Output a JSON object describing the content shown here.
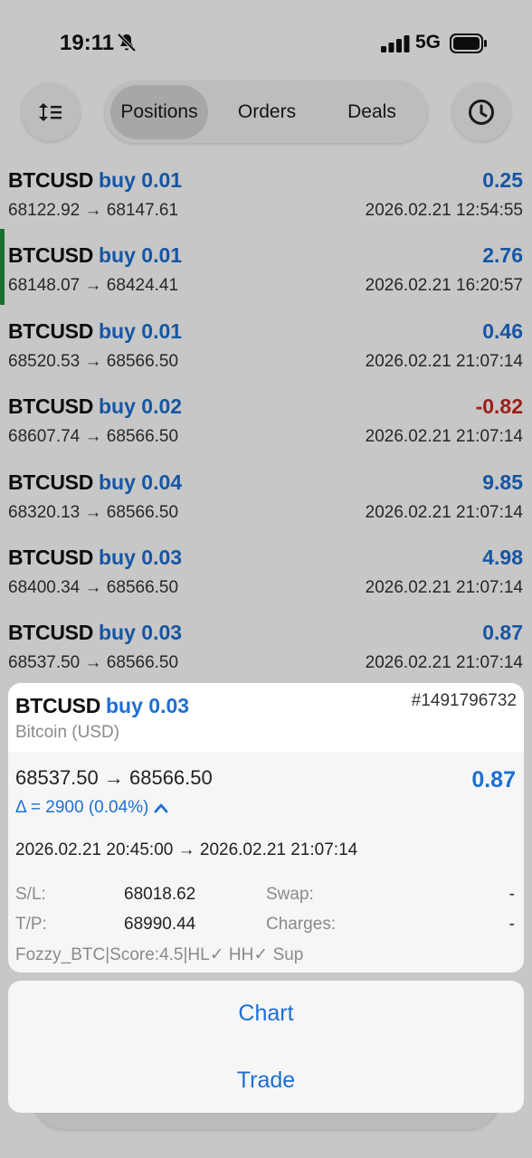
{
  "status": {
    "time": "19:11",
    "network": "5G"
  },
  "toolbar": {
    "tabs": [
      {
        "label": "Positions"
      },
      {
        "label": "Orders"
      },
      {
        "label": "Deals"
      }
    ]
  },
  "positions": [
    {
      "symbol": "BTCUSD",
      "side": "buy 0.01",
      "prices": "68122.92 → 68147.61",
      "profit": "0.25",
      "time": "2026.02.21 12:54:55"
    },
    {
      "symbol": "BTCUSD",
      "side": "buy 0.01",
      "prices": "68148.07 → 68424.41",
      "profit": "2.76",
      "time": "2026.02.21 16:20:57"
    },
    {
      "symbol": "BTCUSD",
      "side": "buy 0.01",
      "prices": "68520.53 → 68566.50",
      "profit": "0.46",
      "time": "2026.02.21 21:07:14"
    },
    {
      "symbol": "BTCUSD",
      "side": "buy 0.02",
      "prices": "68607.74 → 68566.50",
      "profit": "-0.82",
      "time": "2026.02.21 21:07:14"
    },
    {
      "symbol": "BTCUSD",
      "side": "buy 0.04",
      "prices": "68320.13 → 68566.50",
      "profit": "9.85",
      "time": "2026.02.21 21:07:14"
    },
    {
      "symbol": "BTCUSD",
      "side": "buy 0.03",
      "prices": "68400.34 → 68566.50",
      "profit": "4.98",
      "time": "2026.02.21 21:07:14"
    },
    {
      "symbol": "BTCUSD",
      "side": "buy 0.03",
      "prices": "68537.50 → 68566.50",
      "profit": "0.87",
      "time": "2026.02.21 21:07:14"
    }
  ],
  "detail": {
    "symbol": "BTCUSD",
    "side": "buy 0.03",
    "ticket": "#1491796732",
    "name": "Bitcoin (USD)",
    "prices": "68537.50 → 68566.50",
    "profit": "0.87",
    "delta": "Δ = 2900 (0.04%)",
    "times": "2026.02.21 20:45:00 → 2026.02.21 21:07:14",
    "sl_label": "S/L:",
    "sl_value": "68018.62",
    "tp_label": "T/P:",
    "tp_value": "68990.44",
    "swap_label": "Swap:",
    "swap_value": "-",
    "charges_label": "Charges:",
    "charges_value": "-",
    "comment": "Fozzy_BTC|Score:4.5|HL✓ HH✓ Sup"
  },
  "sheet": {
    "chart": "Chart",
    "trade": "Trade"
  },
  "colors": {
    "profit": "#1d6fd1",
    "loss": "#c8281f",
    "accent_bar": "#1f8f3a"
  },
  "icons": [
    "bell-slash-icon",
    "signal-icon",
    "battery-icon",
    "sort-icon",
    "clock-icon",
    "chevron-up-icon"
  ]
}
